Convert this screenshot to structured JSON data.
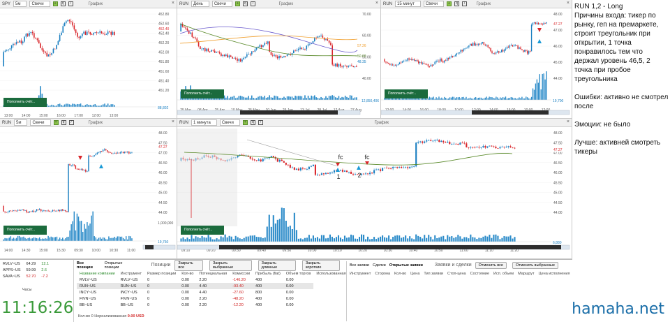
{
  "panes": [
    {
      "ticker": "SPY",
      "interval": "5м",
      "type": "Свечи",
      "title": "График",
      "deposit": "Пополнить счёт...",
      "last": "452.40",
      "volume_label": "88,802",
      "ticks": [
        "452.80",
        "452.60",
        "452.40",
        "452.20",
        "452.00",
        "451.80",
        "451.60",
        "451.40",
        "451.20"
      ],
      "times": [
        "13:00",
        "14:00",
        "15:00",
        "16:00",
        "17:00",
        "12:00",
        "13:00"
      ]
    },
    {
      "ticker": "RUN",
      "interval": "День",
      "type": "Свечи",
      "title": "График",
      "deposit": "Пополнить счёт...",
      "last1": "57.26",
      "last2": "50.00",
      "last3": "48.35",
      "ticks": [
        "70.00",
        "60.00",
        "50.00",
        "40.00"
      ],
      "volume_label": "12,850,406",
      "times": [
        "25 Mar",
        "08 Apr",
        "25 Apr",
        "10 May",
        "25 May",
        "10 Jun",
        "25 Jun",
        "13 Jul",
        "28 Jul",
        "12 Aug",
        "27 Aug"
      ]
    },
    {
      "ticker": "RUN",
      "interval": "15 минут",
      "type": "Свечи",
      "title": "График",
      "deposit": "Пополнить счёт...",
      "last": "47.27",
      "ticks": [
        "48.00",
        "47.00",
        "46.00",
        "45.00",
        "44.00"
      ],
      "volume_label": "19,700",
      "times": [
        "12:00",
        "14:00",
        "16:00",
        "18:00",
        "10:00",
        "12:00",
        "14:00",
        "16:00",
        "10:00",
        "12:00"
      ]
    },
    {
      "ticker": "RUN",
      "interval": "5м",
      "type": "Свечи",
      "title": "График",
      "deposit": "Пополнить счёт...",
      "last": "47.27",
      "ticks": [
        "48.00",
        "47.50",
        "47.00",
        "46.50",
        "46.00",
        "45.50",
        "45.00",
        "44.50",
        "44.00"
      ],
      "volume_label": "19,760",
      "vtop": "1,000,000",
      "times": [
        "14:00",
        "14:30",
        "15:00",
        "15:30",
        "09:30",
        "10:00",
        "10:30",
        "11:00"
      ]
    },
    {
      "ticker": "RUN",
      "interval": "1 минута",
      "type": "Свечи",
      "title": "График",
      "deposit": "Пополнить счёт...",
      "last": "47.27",
      "ticks": [
        "48.00",
        "47.50",
        "47.00",
        "46.50",
        "46.00",
        "45.50",
        "45.00",
        "44.50",
        "44.00"
      ],
      "volume_label": "6,880",
      "times": [
        "09:10",
        "09:20",
        "09:30",
        "09:40",
        "09:50",
        "10:00",
        "10:10",
        "10:20",
        "10:30",
        "10:40",
        "10:50",
        "11:00",
        "11:10",
        "11:20"
      ],
      "annot": [
        "fc",
        "fc",
        "1",
        "2"
      ]
    }
  ],
  "watch": [
    {
      "s": "RVLV~US",
      "p": "64.29",
      "c": "12.1"
    },
    {
      "s": "APPS~US",
      "p": "59.99",
      "c": "2.6"
    },
    {
      "s": "SAVA~US",
      "p": "52.70",
      "c": "-7.2"
    }
  ],
  "clock": {
    "label": "Часы",
    "time": "11:16:26"
  },
  "positions": {
    "tab1": "Все позиции",
    "tab2": "Открытые позиции",
    "title": "Позиции",
    "buttons": [
      "Закрыть все",
      "Закрыть выбранные",
      "Закрыть длинные",
      "Закрыть короткие"
    ],
    "headers": [
      "Название компании",
      "Инструмент",
      "Размер позиции",
      "Кол-во",
      "Потенциальная",
      "Комиссии",
      "Прибыль (fiat)",
      "Объем торгов",
      "Использованная"
    ],
    "rows": [
      [
        "RVLV~US",
        "RVLV~US",
        "0",
        "0.00",
        "2.20",
        "-146.20",
        "400",
        "0.00"
      ],
      [
        "RUN~US",
        "RUN~US",
        "0",
        "0.00",
        "4.40",
        "-93.40",
        "400",
        "0.00"
      ],
      [
        "INCY~US",
        "INCY~US",
        "0",
        "0.00",
        "4.40",
        "-27.60",
        "800",
        "0.00"
      ],
      [
        "FIVN~US",
        "FIVN~US",
        "0",
        "0.00",
        "2.20",
        "-48.20",
        "400",
        "0.00"
      ],
      [
        "BB~US",
        "BB~US",
        "0",
        "0.00",
        "2.20",
        "-12.20",
        "400",
        "0.00"
      ]
    ],
    "footer": "Кол-во 0  Нереализованная",
    "footer_val": "0.00 USD"
  },
  "orders": {
    "tabs": [
      "Все заявки",
      "Сделки",
      "Открытые заявки"
    ],
    "title": "Заявки и сделки",
    "buttons": [
      "Отменить все",
      "Отменить выбранные"
    ],
    "headers": [
      "Инструмент",
      "Сторона",
      "Кол-во",
      "Цена",
      "Тип заявки",
      "Стоп-цена",
      "Состояние",
      "Исп. объем",
      "Маршрут",
      "Цена исполнения"
    ]
  },
  "notes": {
    "title": "RUN 1,2 - Long",
    "reasons": "Причины входа: тикер по рынку, геп на премаркете, строит треугольник при открытии, 1 точка понравилось тем что держал уровень 46,5, 2 точка при пробое треугольника",
    "errors": "Ошибки: активно не смотрел после",
    "emotions": "Эмоции: не было",
    "better": "Лучше: активней смотреть тикеры"
  },
  "watermark": "hamaha.net",
  "colors": {
    "up": "#1a7fc1",
    "down": "#d9252a",
    "deposit": "#1b6b3d",
    "clock": "#3a9a3a"
  },
  "chart_data": [
    {
      "type": "candlestick",
      "ticker": "SPY",
      "interval": "5м",
      "ylim": [
        451.2,
        452.8
      ],
      "last": 452.4
    },
    {
      "type": "candlestick",
      "ticker": "RUN",
      "interval": "День",
      "ylim": [
        40,
        70
      ],
      "series": [
        {
          "name": "MA",
          "values": []
        }
      ]
    },
    {
      "type": "candlestick",
      "ticker": "RUN",
      "interval": "15 минут",
      "ylim": [
        44,
        48
      ],
      "last": 47.27
    },
    {
      "type": "candlestick",
      "ticker": "RUN",
      "interval": "5м",
      "ylim": [
        44,
        48
      ],
      "last": 47.27
    },
    {
      "type": "candlestick",
      "ticker": "RUN",
      "interval": "1 минута",
      "ylim": [
        44,
        48
      ],
      "last": 47.27
    }
  ]
}
